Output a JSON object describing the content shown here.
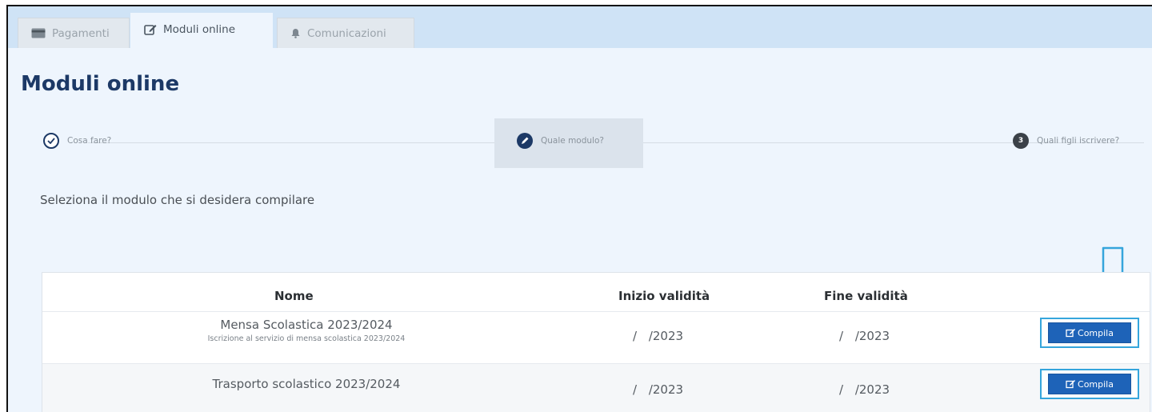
{
  "tabs": [
    {
      "label": "Pagamenti",
      "icon": "credit-card-icon",
      "active": false
    },
    {
      "label": "Moduli online",
      "icon": "edit-icon",
      "active": true
    },
    {
      "label": "Comunicazioni",
      "icon": "bell-icon",
      "active": false
    }
  ],
  "page": {
    "title": "Moduli online"
  },
  "stepper": {
    "steps": [
      {
        "label": "Cosa fare?",
        "state": "done",
        "icon": "check-circle-icon"
      },
      {
        "label": "Quale modulo?",
        "state": "current",
        "icon": "pencil-icon"
      },
      {
        "number": "3",
        "label": "Quali figli iscrivere?",
        "state": "pending"
      }
    ]
  },
  "instruction": "Seleziona il modulo che si desidera compilare",
  "table": {
    "headers": {
      "nome": "Nome",
      "inizio": "Inizio validità",
      "fine": "Fine validità"
    },
    "rows": [
      {
        "title": "Mensa Scolastica 2023/2024",
        "description": "Iscrizione al servizio di mensa scolastica 2023/2024",
        "inizio": "/ /2023",
        "fine": "/ /2023",
        "action": "Compila"
      },
      {
        "title": "Trasporto scolastico 2023/2024",
        "description": "",
        "inizio": "/ /2023",
        "fine": "/ /2023",
        "action": "Compila"
      }
    ]
  },
  "colors": {
    "primary": "#1c3966",
    "button": "#1e63b8",
    "highlight": "#35a5dc",
    "background": "#eef5fd"
  }
}
